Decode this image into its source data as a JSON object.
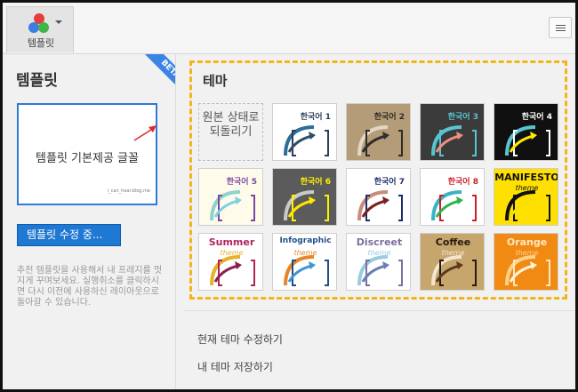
{
  "toolbar": {
    "template_button_label": "템플릿",
    "template_icon": "color-dots-icon",
    "menu_icon": "hamburger-menu-icon"
  },
  "left_panel": {
    "title": "템플릿",
    "beta_badge": "BETA",
    "preview_text": "템플릿 기본제공 글꼴",
    "preview_blog": "i_can_hear.blog.me",
    "edit_button_label": "템플릿 수정 중...",
    "help_text": "추천 템플릿을 사용해서 내 프레지를 멋지게 꾸며보세요. 실행취소를 클릭하시면 다시 이전에 사용하신 레이아웃으로 돌아갈 수 있습니다."
  },
  "theme_panel": {
    "title": "테마",
    "reset_label": "원본 상태로 되돌리기",
    "themes": [
      {
        "label": "한국어 1",
        "subtitle": "",
        "bg": "#ffffff",
        "fg": "#2d3e58",
        "arc": "#2e6f9a",
        "arrow": "#2d4f6c"
      },
      {
        "label": "한국어 2",
        "subtitle": "",
        "bg": "#b59c78",
        "fg": "#2e2a24",
        "arc": "#e2d7c6",
        "arrow": "#2f2f2f"
      },
      {
        "label": "한국어 3",
        "subtitle": "",
        "bg": "#3b3b3b",
        "fg": "#59c3d1",
        "arc": "#59c3d1",
        "arrow": "#ef8e7f"
      },
      {
        "label": "한국어 4",
        "subtitle": "",
        "bg": "#101010",
        "fg": "#ffffff",
        "arc": "#59c3d1",
        "arrow": "#ffe800"
      },
      {
        "label": "한국어 5",
        "subtitle": "",
        "bg": "#fffbea",
        "fg": "#7a48a6",
        "arc": "#8ed4cd",
        "arrow": "#7fd0e4"
      },
      {
        "label": "한국어 6",
        "subtitle": "",
        "bg": "#5b5b5b",
        "fg": "#fff200",
        "arc": "#c9c9c9",
        "arrow": "#ffe800"
      },
      {
        "label": "한국어 7",
        "subtitle": "",
        "bg": "#ffffff",
        "fg": "#1f2d6b",
        "arc": "#c98b7b",
        "arrow": "#7a1f1f"
      },
      {
        "label": "한국어 8",
        "subtitle": "",
        "bg": "#ffffff",
        "fg": "#cc1e2a",
        "arc": "#3bb3c5",
        "arrow": "#2db24e"
      },
      {
        "label": "MANIFESTO",
        "subtitle": "theme",
        "bg": "#ffe000",
        "fg": "#111111",
        "arc": "#111111",
        "arrow": "#f3e100"
      },
      {
        "label": "Summer",
        "subtitle": "theme",
        "bg": "#ffffff",
        "fg": "#b0245d",
        "arc": "#e6b22b",
        "arrow": "#8b1f4d"
      },
      {
        "label": "Infographic",
        "subtitle": "theme",
        "bg": "#ffffff",
        "fg": "#1f4f86",
        "arc": "#e6862b",
        "arrow": "#4196d3"
      },
      {
        "label": "Discreet",
        "subtitle": "theme",
        "bg": "#ffffff",
        "fg": "#7c6fa0",
        "arc": "#9bcbe0",
        "arrow": "#6b7fb0"
      },
      {
        "label": "Coffee",
        "subtitle": "theme",
        "bg": "#c7a66e",
        "fg": "#2a1a0e",
        "arc": "#f2e6cf",
        "arrow": "#5a3a1e"
      },
      {
        "label": "Orange",
        "subtitle": "theme",
        "bg": "#f08a12",
        "fg": "#ffe7c2",
        "arc": "#ffd08a",
        "arrow": "#fff3dd"
      }
    ]
  },
  "links": {
    "edit_current_theme": "현재 테마 수정하기",
    "save_my_theme": "내 테마 저장하기"
  }
}
